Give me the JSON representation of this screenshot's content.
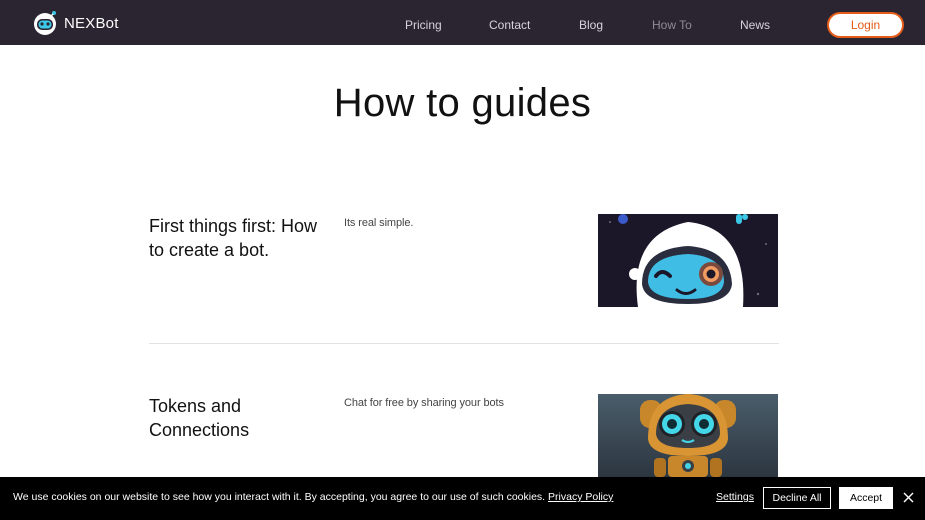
{
  "header": {
    "brand": "NEXBot",
    "nav": [
      "Pricing",
      "Contact",
      "Blog",
      "How To",
      "News"
    ],
    "active_nav": "How To",
    "login_label": "Login"
  },
  "main": {
    "title": "How to guides",
    "guides": [
      {
        "title": "First things first: How to create a bot.",
        "description": "Its real simple."
      },
      {
        "title": "Tokens and Connections",
        "description": "Chat for free by sharing your bots"
      }
    ]
  },
  "cookie_bar": {
    "message": "We use cookies on our website to see how you interact with it. By accepting, you agree to our use of such cookies.",
    "policy_link": "Privacy Policy",
    "settings_label": "Settings",
    "decline_label": "Decline All",
    "accept_label": "Accept"
  },
  "colors": {
    "header_bg": "#2a2531",
    "accent": "#e35c19",
    "cookie_bg": "#000000"
  },
  "icons": [
    "nexbot-logo-icon",
    "robot-wink-illustration",
    "orange-robot-illustration",
    "close-icon"
  ]
}
